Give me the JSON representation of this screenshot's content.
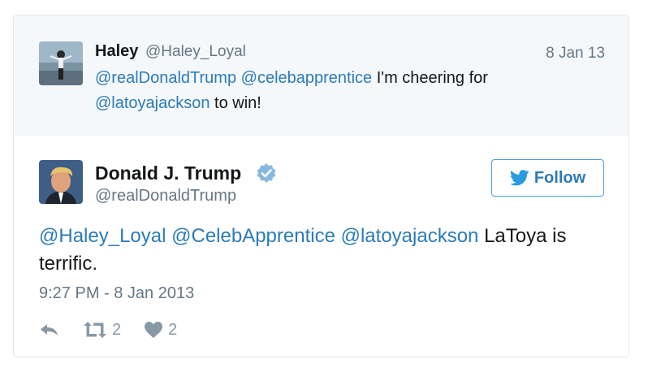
{
  "parent_tweet": {
    "name": "Haley",
    "handle": "@Haley_Loyal",
    "date": "8 Jan 13",
    "mention1": "@realDonaldTrump",
    "mention2": "@celebapprentice",
    "text1": "I'm cheering for",
    "mention3": "@latoyajackson",
    "text2": "to win!"
  },
  "main_tweet": {
    "name": "Donald J. Trump",
    "handle": "@realDonaldTrump",
    "follow_label": "Follow",
    "mention1": "@Haley_Loyal",
    "mention2": "@CelebApprentice",
    "mention3": "@latoyajackson",
    "text": "LaToya is terrific.",
    "timestamp": "9:27 PM - 8 Jan 2013",
    "retweet_count": "2",
    "like_count": "2"
  },
  "colors": {
    "link": "#2b7bb9",
    "muted": "#657786",
    "verified": "#1da1f2",
    "parent_background": "#f5f8fa"
  },
  "icons": [
    "verified-badge-icon",
    "twitter-bird-icon",
    "reply-icon",
    "retweet-icon",
    "heart-icon"
  ]
}
